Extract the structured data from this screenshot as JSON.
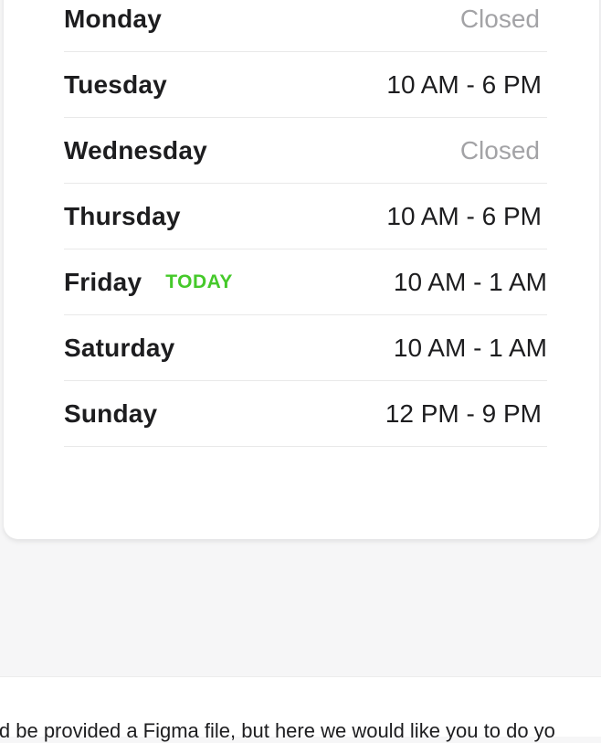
{
  "hours": [
    {
      "day": "Monday",
      "hours": "Closed",
      "closed": true,
      "today": false
    },
    {
      "day": "Tuesday",
      "hours": "10 AM - 6 PM",
      "closed": false,
      "today": false
    },
    {
      "day": "Wednesday",
      "hours": "Closed",
      "closed": true,
      "today": false
    },
    {
      "day": "Thursday",
      "hours": "10 AM - 6 PM",
      "closed": false,
      "today": false
    },
    {
      "day": "Friday",
      "hours": "10 AM - 1 AM",
      "closed": false,
      "today": true
    },
    {
      "day": "Saturday",
      "hours": "10 AM - 1 AM",
      "closed": false,
      "today": false
    },
    {
      "day": "Sunday",
      "hours": "12 PM - 9 PM",
      "closed": false,
      "today": false
    }
  ],
  "today_label": "TODAY",
  "footer": {
    "text": "ld be provided a Figma file, but here we would like you to do yo"
  },
  "colors": {
    "today": "#45c92a",
    "closed": "#a3a3a6",
    "text": "#1d1d1f"
  }
}
